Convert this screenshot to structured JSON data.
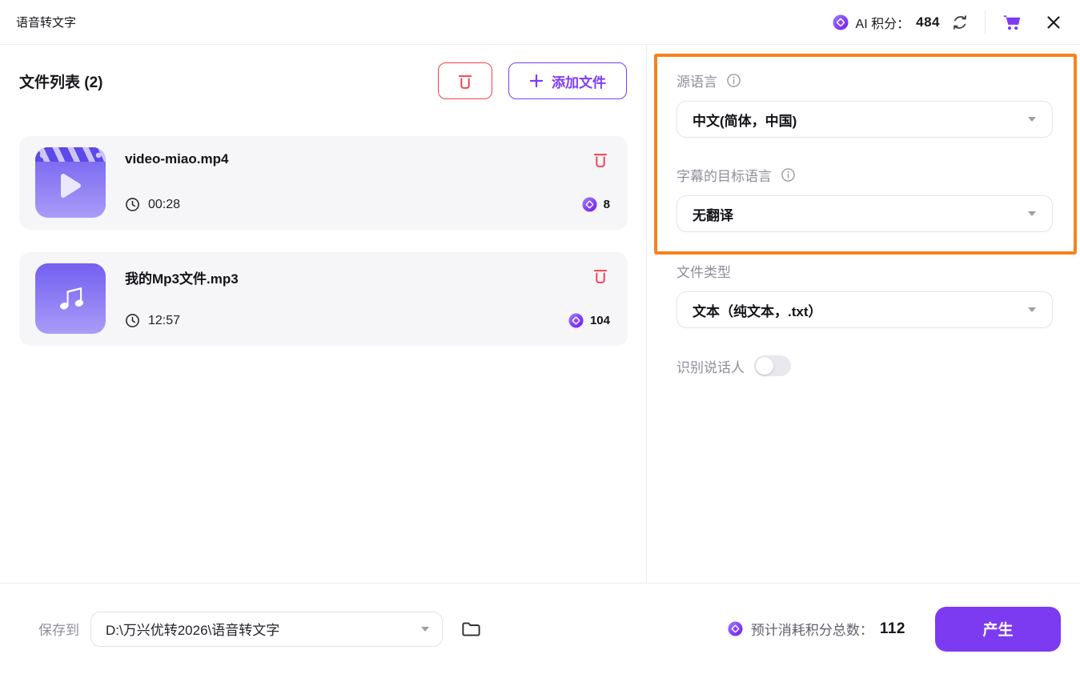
{
  "header": {
    "title": "语音转文字",
    "credits_label": "AI 积分：",
    "credits_value": "484"
  },
  "file_list": {
    "title": "文件列表 (2)",
    "add_button_label": "添加文件",
    "files": [
      {
        "name": "video-miao.mp4",
        "duration": "00:28",
        "credits": "8"
      },
      {
        "name": "我的Mp3文件.mp3",
        "duration": "12:57",
        "credits": "104"
      }
    ]
  },
  "settings": {
    "source_language_label": "源语言",
    "source_language_value": "中文(简体，中国)",
    "target_language_label": "字幕的目标语言",
    "target_language_value": "无翻译",
    "file_type_label": "文件类型",
    "file_type_value": "文本（纯文本，.txt）",
    "speaker_toggle_label": "识别说话人",
    "speaker_toggle_state": "off"
  },
  "footer": {
    "save_label": "保存到",
    "save_path": "D:\\万兴优转2026\\语音转文字",
    "estimate_label": "预计消耗积分总数：",
    "estimate_value": "112",
    "generate_label": "产生"
  },
  "colors": {
    "accent_purple": "#7c3bf0",
    "danger_red": "#f5404d",
    "highlight_orange": "#f6831d"
  }
}
